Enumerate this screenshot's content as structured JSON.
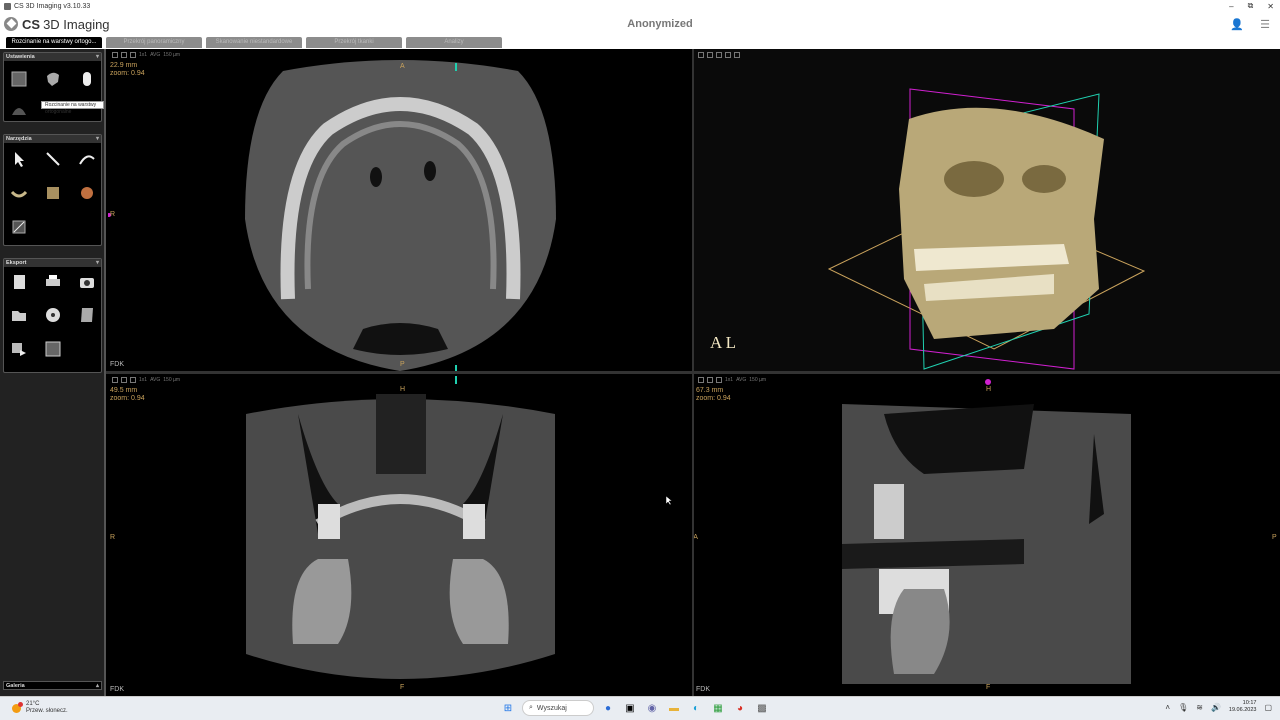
{
  "window": {
    "title": "CS 3D Imaging v3.10.33",
    "min": "–",
    "restore": "⧉",
    "close": "✕"
  },
  "header": {
    "brand_bold": "CS",
    "brand_rest": "3D Imaging",
    "patient": "Anonymized"
  },
  "tabs": [
    {
      "label": "Rozcinanie na warstwy ortogo..."
    },
    {
      "label": "Przekrój panoramiczny"
    },
    {
      "label": "Skanowanie niestandardowe"
    },
    {
      "label": "Przekrój tkanki"
    },
    {
      "label": "Analizy"
    }
  ],
  "tooltip": "Rozcinanie na warstwy ortogonalne",
  "panel": {
    "group_settings": "Ustawienia",
    "group_tools": "Narzędzia",
    "group_export": "Eksport",
    "group_gallery": "Galeria"
  },
  "toolbar": {
    "layout": "1x1",
    "avg": "AVG",
    "thickness": "150 µm"
  },
  "views": {
    "axial": {
      "depth": "22.9 mm",
      "zoom": "zoom: 0.94",
      "top": "A",
      "left": "R",
      "bottom": "P",
      "recon": "FDK"
    },
    "coronal": {
      "depth": "49.5 mm",
      "zoom": "zoom: 0.94",
      "top": "H",
      "left": "R",
      "bottom": "F",
      "recon": "FDK"
    },
    "sagittal": {
      "depth": "67.3 mm",
      "zoom": "zoom: 0.94",
      "top": "H",
      "left": "L A",
      "right": "P",
      "bottom": "F",
      "recon": "FDK"
    },
    "volume": {
      "orient": "A L"
    }
  },
  "taskbar": {
    "temp": "21°C",
    "weather": "Przew. słonecz.",
    "search": "Wyszukaj",
    "time": "10:17",
    "date": "19.06.2023"
  },
  "colors": {
    "orange": "#c9a25c",
    "magenta": "#d020d0",
    "cyan": "#20d0b0",
    "bone": "#c8b88a"
  }
}
